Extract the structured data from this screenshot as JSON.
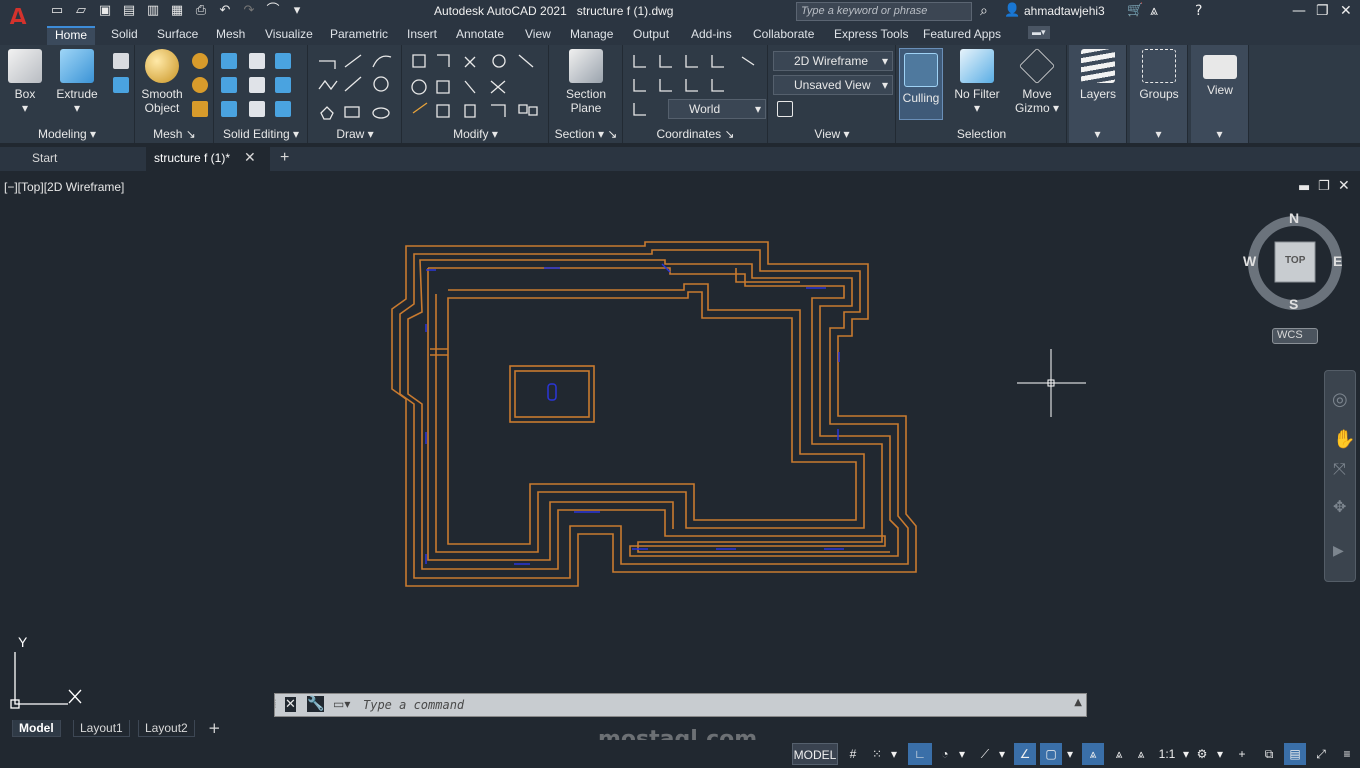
{
  "app": {
    "title": "Autodesk AutoCAD 2021",
    "filename": "structure f (1).dwg",
    "search_placeholder": "Type a keyword or phrase",
    "user": "ahmadtawjehi3"
  },
  "ribbon_tabs": [
    "Home",
    "Solid",
    "Surface",
    "Mesh",
    "Visualize",
    "Parametric",
    "Insert",
    "Annotate",
    "View",
    "Manage",
    "Output",
    "Add-ins",
    "Collaborate",
    "Express Tools",
    "Featured Apps"
  ],
  "ribbon": {
    "modeling": {
      "label": "Modeling",
      "box": "Box",
      "extrude": "Extrude"
    },
    "mesh": {
      "label": "Mesh",
      "smooth1": "Smooth",
      "smooth2": "Object"
    },
    "solid_editing": {
      "label": "Solid Editing"
    },
    "draw": {
      "label": "Draw"
    },
    "modify": {
      "label": "Modify"
    },
    "section": {
      "label": "Section",
      "btn1": "Section",
      "btn2": "Plane"
    },
    "coordinates": {
      "label": "Coordinates",
      "world": "World"
    },
    "view": {
      "label": "View",
      "visual_style": "2D Wireframe",
      "named_view": "Unsaved View"
    },
    "selection": {
      "label": "Selection",
      "culling": "Culling",
      "nofilter": "No Filter",
      "move1": "Move",
      "move2": "Gizmo"
    },
    "layers": "Layers",
    "groups": "Groups",
    "view_btn": "View"
  },
  "doc_tabs": {
    "start": "Start",
    "active": "structure f (1)*"
  },
  "viewport": {
    "label": "[−][Top][2D Wireframe]",
    "compass": {
      "n": "N",
      "s": "S",
      "e": "E",
      "w": "W",
      "cube": "TOP",
      "wcs": "WCS"
    },
    "ucs": {
      "y": "Y",
      "x": "X"
    }
  },
  "command": {
    "placeholder": "Type a command"
  },
  "layout_tabs": [
    "Model",
    "Layout1",
    "Layout2"
  ],
  "status": {
    "model": "MODEL",
    "scale": "1:1"
  },
  "watermark": "mostaql.com",
  "colors": {
    "wall": "#c87a2f",
    "blue": "#2a35d8",
    "bg": "#212830"
  }
}
